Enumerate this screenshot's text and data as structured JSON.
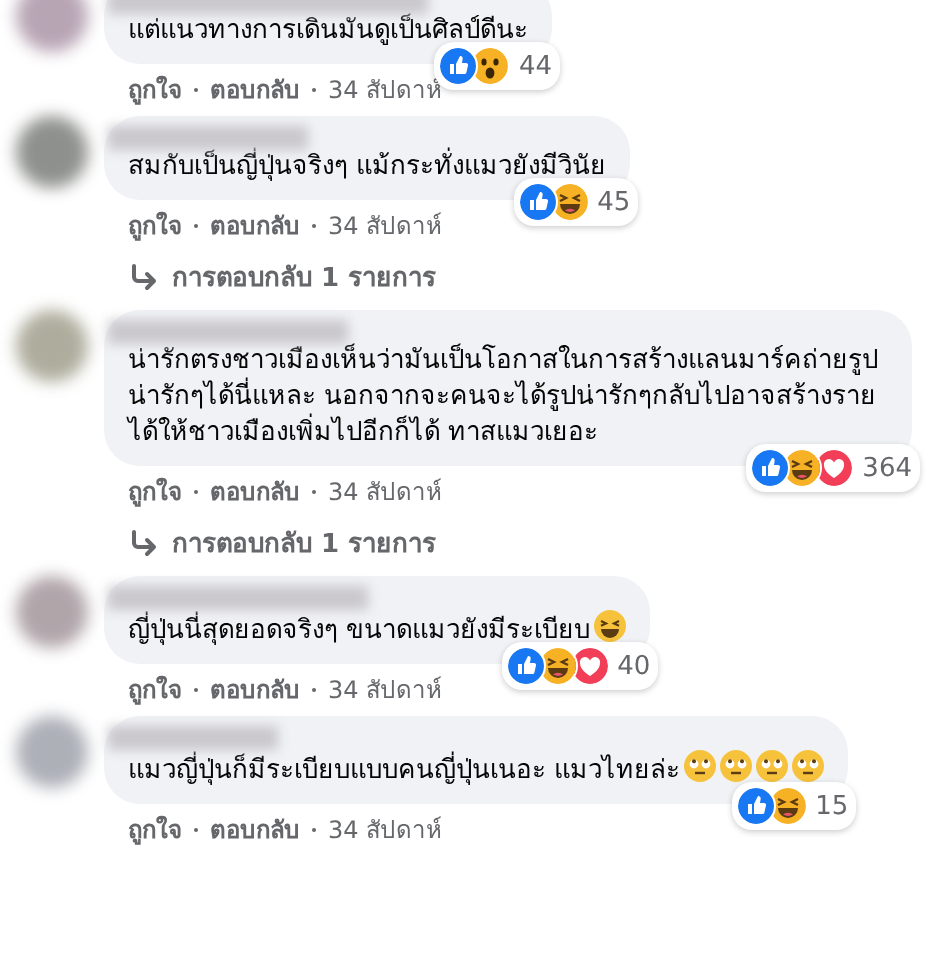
{
  "comments": [
    {
      "text": "แต่แนวทางการเดินมันดูเป็นศิลป์ดีนะ",
      "reactions": [
        {
          "kind": "like"
        },
        {
          "kind": "wow"
        }
      ],
      "reaction_count": "44",
      "actions": [
        "ถูกใจ",
        "ตอบกลับ"
      ],
      "time": "34 สัปดาห์"
    },
    {
      "text": "สมกับเป็นญี่ปุ่นจริงๆ แม้กระทั่งแมวยังมีวินัย",
      "reactions": [
        {
          "kind": "like"
        },
        {
          "kind": "haha"
        }
      ],
      "reaction_count": "45",
      "actions": [
        "ถูกใจ",
        "ตอบกลับ"
      ],
      "time": "34 สัปดาห์",
      "replies": "การตอบกลับ 1 รายการ"
    },
    {
      "text": "น่ารักตรงชาวเมืองเห็นว่ามันเป็นโอกาสในการสร้างแลนมาร์คถ่ายรูปน่ารักๆได้นี่แหละ นอกจากจะคนจะได้รูปน่ารักๆกลับไปอาจสร้างรายได้ให้ชาวเมืองเพิ่มไปอีกก็ได้ ทาสแมวเยอะ",
      "reactions": [
        {
          "kind": "like"
        },
        {
          "kind": "haha"
        },
        {
          "kind": "love"
        }
      ],
      "reaction_count": "364",
      "actions": [
        "ถูกใจ",
        "ตอบกลับ"
      ],
      "time": "34 สัปดาห์",
      "replies": "การตอบกลับ 1 รายการ"
    },
    {
      "text": "ญี่ปุ่นนี่สุดยอดจริงๆ ขนาดแมวยังมีระเบียบ",
      "emojis": [
        {
          "kind": "laugh"
        }
      ],
      "reactions": [
        {
          "kind": "like"
        },
        {
          "kind": "haha"
        },
        {
          "kind": "love"
        }
      ],
      "reaction_count": "40",
      "actions": [
        "ถูกใจ",
        "ตอบกลับ"
      ],
      "time": "34 สัปดาห์"
    },
    {
      "text": "แมวญี่ปุ่นก็มีระเบียบแบบคนญี่ปุ่นเนอะ แมวไทยล่ะ",
      "emojis": [
        {
          "kind": "eyeroll"
        },
        {
          "kind": "eyeroll"
        },
        {
          "kind": "eyeroll"
        },
        {
          "kind": "eyeroll"
        }
      ],
      "reactions": [
        {
          "kind": "like"
        },
        {
          "kind": "haha"
        }
      ],
      "reaction_count": "15",
      "actions": [
        "ถูกใจ",
        "ตอบกลับ"
      ],
      "time": "34 สัปดาห์"
    }
  ]
}
